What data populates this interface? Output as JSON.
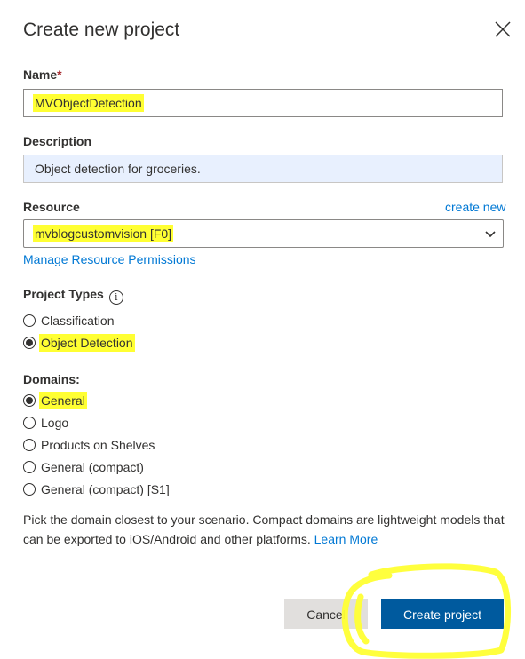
{
  "dialog": {
    "title": "Create new project"
  },
  "name_field": {
    "label": "Name",
    "required_mark": "*",
    "value": "MVObjectDetection"
  },
  "description_field": {
    "label": "Description",
    "value": "Object detection for groceries."
  },
  "resource_field": {
    "label": "Resource",
    "create_new_link": "create new",
    "selected": "mvblogcustomvision [F0]",
    "manage_link": "Manage Resource Permissions"
  },
  "project_types": {
    "label": "Project Types",
    "info_glyph": "i",
    "options": [
      {
        "label": "Classification",
        "checked": false
      },
      {
        "label": "Object Detection",
        "checked": true
      }
    ]
  },
  "domains": {
    "label": "Domains:",
    "options": [
      {
        "label": "General",
        "checked": true
      },
      {
        "label": "Logo",
        "checked": false
      },
      {
        "label": "Products on Shelves",
        "checked": false
      },
      {
        "label": "General (compact)",
        "checked": false
      },
      {
        "label": "General (compact) [S1]",
        "checked": false
      }
    ]
  },
  "hint": {
    "text": "Pick the domain closest to your scenario. Compact domains are lightweight models that can be exported to iOS/Android and other platforms.",
    "link": "Learn More"
  },
  "footer": {
    "cancel_label": "Cancel",
    "create_label": "Create project"
  },
  "colors": {
    "highlight": "#ffff33",
    "accent": "#0078d4",
    "primary_button": "#005a9e"
  }
}
